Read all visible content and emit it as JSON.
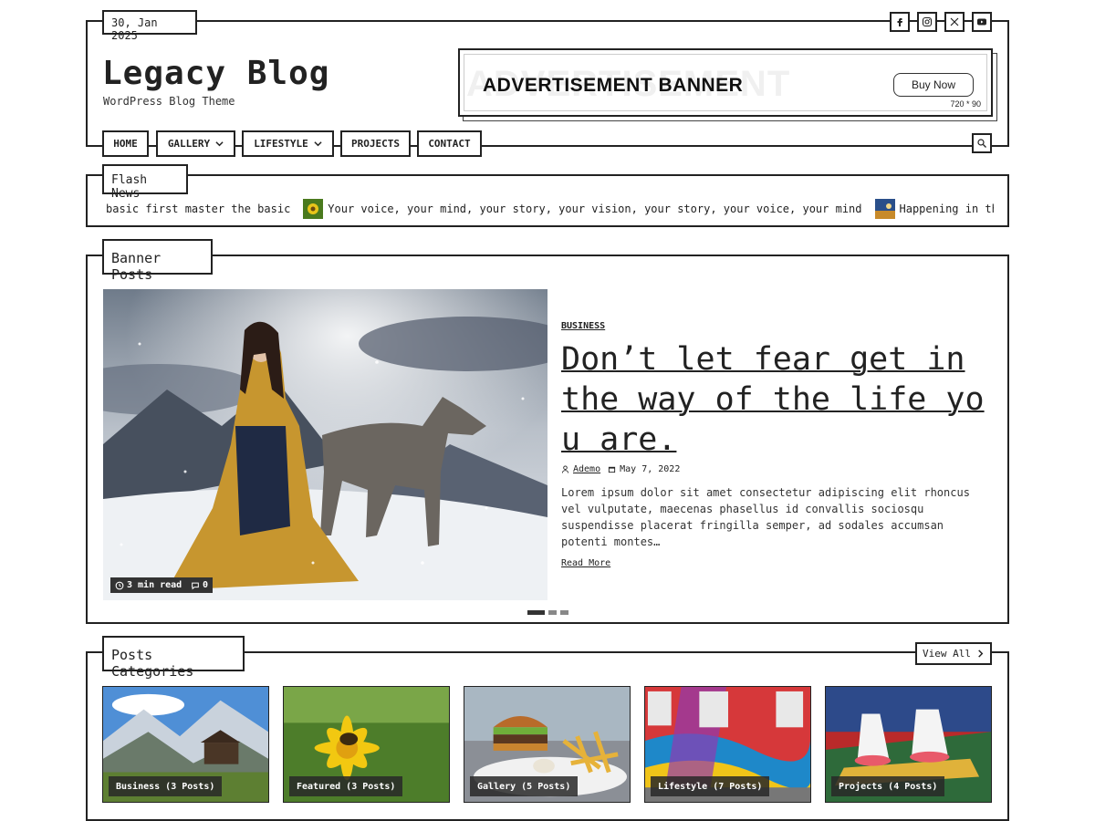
{
  "header": {
    "date": "30, Jan 2025",
    "site_title": "Legacy Blog",
    "tagline": "WordPress Blog Theme",
    "social": [
      "facebook-icon",
      "instagram-icon",
      "x-icon",
      "youtube-icon"
    ]
  },
  "ad": {
    "ghost_text": "ADVERTISEMENT",
    "title": "ADVERTISEMENT BANNER",
    "button": "Buy Now",
    "size": "720 * 90"
  },
  "nav": {
    "items": [
      {
        "label": "HOME"
      },
      {
        "label": "GALLERY",
        "has_dropdown": true
      },
      {
        "label": "LIFESTYLE",
        "has_dropdown": true
      },
      {
        "label": "PROJECTS"
      },
      {
        "label": "CONTACT"
      }
    ]
  },
  "flash": {
    "label": "Flash News",
    "items": [
      "basic first master the basic",
      "Your voice, your mind, your story, your vision, your story, your voice, your mind",
      "Happening in the worl"
    ]
  },
  "banner": {
    "label": "Banner Posts",
    "read_time": "3 min read",
    "comments": "0",
    "category": "BUSINESS",
    "title": "Don’t let fear get in the way of the life you are.",
    "author": "Ademo",
    "date": "May 7, 2022",
    "excerpt": "Lorem ipsum dolor sit amet consectetur adipiscing elit rhoncus vel vulputate, maecenas phasellus id convallis sociosqu suspendisse placerat fringilla semper, ad sodales accumsan potenti montes…",
    "read_more": "Read More",
    "slides": 3,
    "active_slide": 1
  },
  "categories": {
    "label": "Posts Categories",
    "view_all": "View All",
    "items": [
      {
        "label": "Business (3 Posts)"
      },
      {
        "label": "Featured (3 Posts)"
      },
      {
        "label": "Gallery (5 Posts)"
      },
      {
        "label": "Lifestyle (7 Posts)"
      },
      {
        "label": "Projects (4 Posts)"
      }
    ]
  },
  "colors": {
    "ink": "#222222",
    "background": "#ffffff",
    "badge": "#333333"
  }
}
